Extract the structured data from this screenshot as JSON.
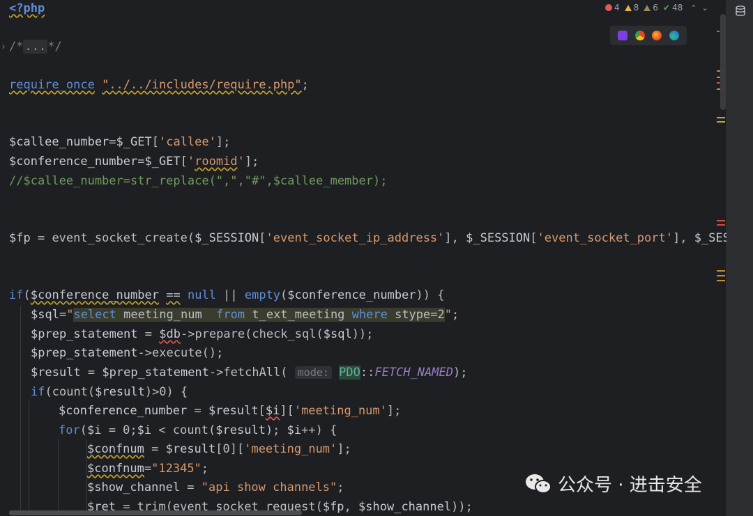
{
  "inspections": {
    "errors": "4",
    "warnings": "8",
    "weak_warnings": "6",
    "typos": "48"
  },
  "browsers": [
    "phpstorm-icon",
    "chrome-icon",
    "firefox-icon",
    "edge-icon"
  ],
  "code": {
    "php_open": "<?php",
    "fold_comment_start": "/*",
    "fold_comment_dots": "...",
    "fold_comment_end": "*/",
    "require_kw": "require_once",
    "require_path": "\"../../includes/require.php\"",
    "l1_var": "$callee_number",
    "l1_get": "$_GET",
    "l1_key": "'callee'",
    "l2_var": "$conference_number",
    "l2_get": "$_GET",
    "l2_key_q1": "'",
    "l2_key": "roomid",
    "l2_key_q2": "'",
    "l3_comment": "//$callee_number=str_replace(\",\",\"#\",$callee_member);",
    "l4_var": "$fp",
    "l4_fn": "event_socket_create",
    "l4_s1": "$_SESSION",
    "l4_k1": "'event_socket_ip_address'",
    "l4_s2": "$_SESSION",
    "l4_k2": "'event_socket_port'",
    "l4_s3": "$_SESS",
    "if_kw": "if",
    "if_var": "$conference_number",
    "if_null": "null",
    "if_empty": "empty",
    "if_var2": "$conference_number",
    "sql_var": "$sql",
    "sql_q": "\"",
    "sql_select": "select",
    "sql_mid1": " meeting_num  ",
    "sql_from": "from",
    "sql_mid2": " t_ext_meeting ",
    "sql_where": "where",
    "sql_mid3": " stype=2",
    "sql_q2": "\"",
    "prep_var": "$prep_statement",
    "prep_db": "$db",
    "prep_fn": "prepare",
    "prep_check": "check_sql",
    "prep_sql": "$sql",
    "exec_var": "$prep_statement",
    "exec_fn": "execute",
    "res_var": "$result",
    "res_prep": "$prep_statement",
    "res_fn": "fetchAll",
    "res_hint": "mode:",
    "res_pdo": "PDO",
    "res_const": "FETCH_NAMED",
    "if2_kw": "if",
    "if2_fn": "count",
    "if2_var": "$result",
    "cn_var": "$conference_number",
    "cn_res": "$result",
    "cn_i": "$i",
    "cn_key": "'meeting_num'",
    "for_kw": "for",
    "for_i1": "$i",
    "for_i2": "$i",
    "for_fn": "count",
    "for_res": "$result",
    "for_i3": "$i",
    "cf1_var": "$confnum",
    "cf1_res": "$result",
    "cf1_key": "'meeting_num'",
    "cf2_var": "$confnum",
    "cf2_val": "\"12345\"",
    "sc_var": "$show_channel",
    "sc_val": "\"api show channels\"",
    "ret_var": "$ret",
    "ret_fn": "trim",
    "ret_fn2": "event_socket_request",
    "ret_fp": "$fp",
    "ret_sc": "$show_channel"
  },
  "watermark": {
    "text": "公众号 · 进击安全"
  }
}
